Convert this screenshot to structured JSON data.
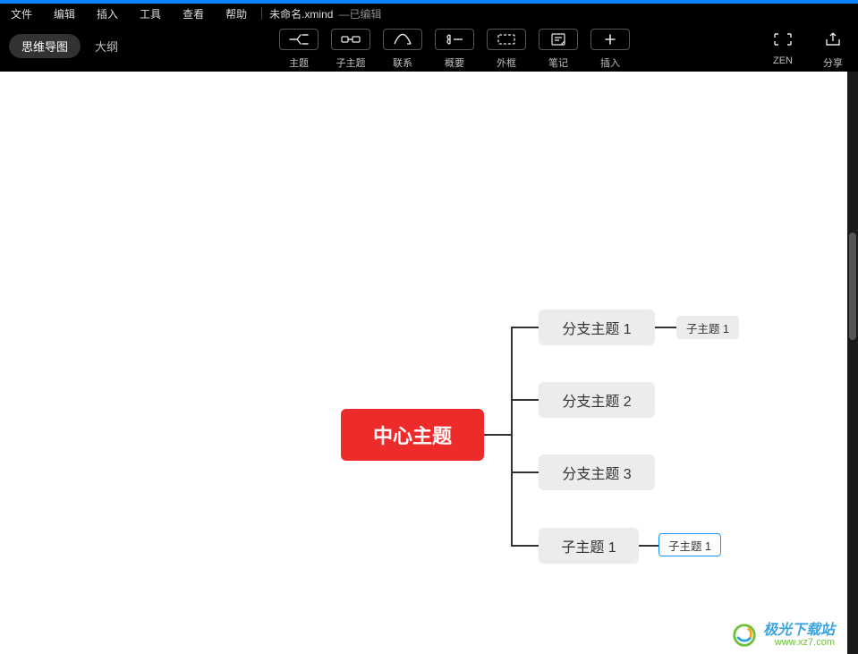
{
  "menu": {
    "items": [
      "文件",
      "编辑",
      "插入",
      "工具",
      "查看",
      "帮助"
    ],
    "filename": "未命名.xmind",
    "filestate": "—已编辑"
  },
  "view": {
    "active": "思维导图",
    "alt": "大纲"
  },
  "tools": {
    "main": [
      {
        "label": "主题",
        "iconName": "topic-icon"
      },
      {
        "label": "子主题",
        "iconName": "subtopic-icon"
      },
      {
        "label": "联系",
        "iconName": "relation-icon"
      },
      {
        "label": "概要",
        "iconName": "summary-icon"
      },
      {
        "label": "外框",
        "iconName": "boundary-icon"
      },
      {
        "label": "笔记",
        "iconName": "note-icon"
      },
      {
        "label": "插入",
        "iconName": "insert-icon"
      }
    ],
    "right": [
      {
        "label": "ZEN",
        "iconName": "zen-icon"
      },
      {
        "label": "分享",
        "iconName": "share-icon"
      }
    ]
  },
  "mindmap": {
    "center": "中心主题",
    "branches": [
      {
        "label": "分支主题 1",
        "children": [
          "子主题 1"
        ]
      },
      {
        "label": "分支主题 2",
        "children": []
      },
      {
        "label": "分支主题 3",
        "children": []
      },
      {
        "label": "子主题 1",
        "children": [
          "子主题 1"
        ]
      }
    ]
  },
  "watermark": {
    "title": "极光下载站",
    "url": "www.xz7.com"
  }
}
